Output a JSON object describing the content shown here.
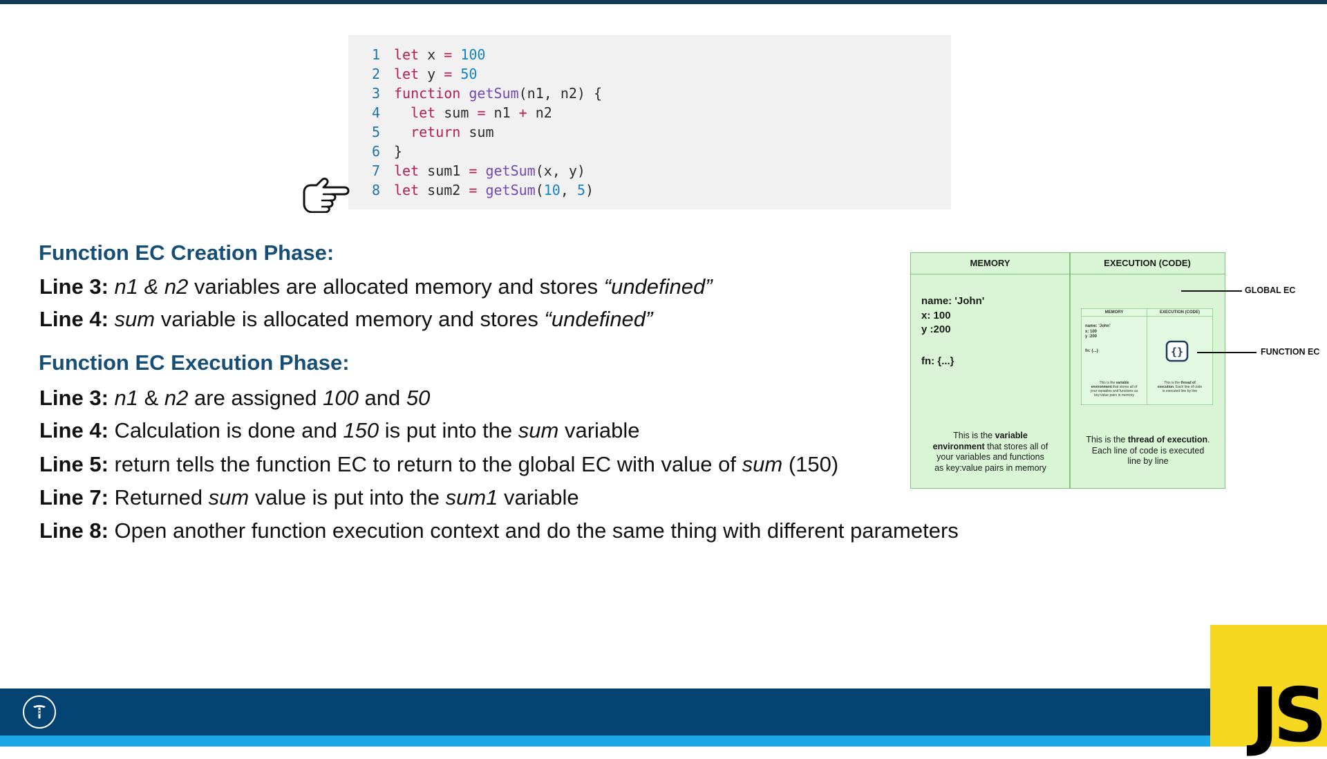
{
  "code": {
    "lines": [
      {
        "num": "1",
        "tokens": [
          {
            "t": "let",
            "c": "kw"
          },
          {
            "t": " x ",
            "c": "pl"
          },
          {
            "t": "=",
            "c": "op"
          },
          {
            "t": " ",
            "c": "pl"
          },
          {
            "t": "100",
            "c": "num"
          }
        ]
      },
      {
        "num": "2",
        "tokens": [
          {
            "t": "let",
            "c": "kw"
          },
          {
            "t": " y ",
            "c": "pl"
          },
          {
            "t": "=",
            "c": "op"
          },
          {
            "t": " ",
            "c": "pl"
          },
          {
            "t": "50",
            "c": "num"
          }
        ]
      },
      {
        "num": "3",
        "tokens": [
          {
            "t": "function",
            "c": "kw"
          },
          {
            "t": " ",
            "c": "pl"
          },
          {
            "t": "getSum",
            "c": "fn"
          },
          {
            "t": "(n1, n2) {",
            "c": "pl"
          }
        ]
      },
      {
        "num": "4",
        "tokens": [
          {
            "t": "  ",
            "c": "pl"
          },
          {
            "t": "let",
            "c": "kw"
          },
          {
            "t": " sum ",
            "c": "pl"
          },
          {
            "t": "=",
            "c": "op"
          },
          {
            "t": " n1 ",
            "c": "pl"
          },
          {
            "t": "+",
            "c": "op"
          },
          {
            "t": " n2",
            "c": "pl"
          }
        ]
      },
      {
        "num": "5",
        "tokens": [
          {
            "t": "  ",
            "c": "pl"
          },
          {
            "t": "return",
            "c": "kw"
          },
          {
            "t": " sum",
            "c": "pl"
          }
        ]
      },
      {
        "num": "6",
        "tokens": [
          {
            "t": "}",
            "c": "pl"
          }
        ]
      },
      {
        "num": "7",
        "tokens": [
          {
            "t": "let",
            "c": "kw"
          },
          {
            "t": " sum1 ",
            "c": "pl"
          },
          {
            "t": "=",
            "c": "op"
          },
          {
            "t": " ",
            "c": "pl"
          },
          {
            "t": "getSum",
            "c": "fn"
          },
          {
            "t": "(x, y)",
            "c": "pl"
          }
        ]
      },
      {
        "num": "8",
        "tokens": [
          {
            "t": "let",
            "c": "kw"
          },
          {
            "t": " sum2 ",
            "c": "pl"
          },
          {
            "t": "=",
            "c": "op"
          },
          {
            "t": " ",
            "c": "pl"
          },
          {
            "t": "getSum",
            "c": "fn"
          },
          {
            "t": "(",
            "c": "pl"
          },
          {
            "t": "10",
            "c": "num"
          },
          {
            "t": ", ",
            "c": "pl"
          },
          {
            "t": "5",
            "c": "num"
          },
          {
            "t": ")",
            "c": "pl"
          }
        ]
      }
    ],
    "current_line": 8
  },
  "creation": {
    "heading": "Function EC Creation Phase:",
    "lines": [
      {
        "label": "Line 3:",
        "segments": [
          {
            "t": "n1",
            "i": true
          },
          {
            "t": " & ",
            "i": true
          },
          {
            "t": "n2",
            "i": true
          },
          {
            "t": " variables are allocated memory and stores ",
            "i": false
          },
          {
            "t": "“undefined”",
            "i": true
          }
        ]
      },
      {
        "label": "Line 4:",
        "segments": [
          {
            "t": "sum",
            "i": true
          },
          {
            "t": " variable is allocated memory and stores ",
            "i": false
          },
          {
            "t": "“undefined”",
            "i": true
          }
        ]
      }
    ]
  },
  "execution": {
    "heading": "Function EC Execution Phase:",
    "lines": [
      {
        "label": "Line 3:",
        "segments": [
          {
            "t": "n1",
            "i": true
          },
          {
            "t": " & ",
            "i": false
          },
          {
            "t": "n2",
            "i": true
          },
          {
            "t": " are assigned ",
            "i": false
          },
          {
            "t": "100",
            "i": true
          },
          {
            "t": " and ",
            "i": false
          },
          {
            "t": "50",
            "i": true
          }
        ]
      },
      {
        "label": "Line 4:",
        "segments": [
          {
            "t": "Calculation is done and ",
            "i": false
          },
          {
            "t": "150",
            "i": true
          },
          {
            "t": " is put into the ",
            "i": false
          },
          {
            "t": "sum",
            "i": true
          },
          {
            "t": " variable",
            "i": false
          }
        ]
      },
      {
        "label": "Line 5:",
        "segments": [
          {
            "t": "return tells the function EC to return to the global EC with value of ",
            "i": false
          },
          {
            "t": "sum",
            "i": true
          },
          {
            "t": " (150)",
            "i": false
          }
        ]
      },
      {
        "label": "Line 7:",
        "segments": [
          {
            "t": "Returned ",
            "i": false
          },
          {
            "t": "sum",
            "i": true
          },
          {
            "t": " value is put into the ",
            "i": false
          },
          {
            "t": "sum1",
            "i": true
          },
          {
            "t": " variable",
            "i": false
          }
        ]
      },
      {
        "label": "Line 8:",
        "segments": [
          {
            "t": "Open another function execution context and do the same thing with different parameters",
            "i": false
          }
        ]
      }
    ]
  },
  "diagram": {
    "memory_header": "MEMORY",
    "execution_header": "EXECUTION (CODE)",
    "memory_values": [
      "name: 'John'",
      "x: 100",
      "y :200"
    ],
    "memory_fn": "fn: {...}",
    "memory_caption": {
      "a": "This is the ",
      "b": "variable environment",
      "c": " that stores all of your variables and functions as key:value pairs in memory"
    },
    "execution_caption": {
      "a": "This is the ",
      "b": "thread of execution",
      "c": ". Each line of code is executed line by line"
    },
    "mini": {
      "memory_header": "MEMORY",
      "execution_header": "EXECUTION (CODE)",
      "memory_values": [
        "name: 'John'",
        "x: 100",
        "y :200"
      ],
      "memory_fn": "fn: {...}",
      "memory_caption": {
        "a": "This is the ",
        "b": "variable environment",
        "c": " that stores all of your variables and functions as key:value pairs in memory"
      },
      "execution_caption": {
        "a": "This is the ",
        "b": "thread of execution",
        "c": ". Each line of code is executed line by line"
      }
    },
    "global_label": "GLOBAL EC",
    "function_label": "FUNCTION EC",
    "fn_icon_glyph": "{}"
  },
  "badge": {
    "text": "JS"
  },
  "colors": {
    "heading": "#174e76",
    "footer": "#054372",
    "footer_strip": "#1ca6e6",
    "js_badge": "#f5d81f",
    "diagram_bg": "#d9f5d6"
  },
  "icons": {
    "pointer": "pointing-hand-icon",
    "footer_logo": "tesla-style-logo-icon"
  }
}
